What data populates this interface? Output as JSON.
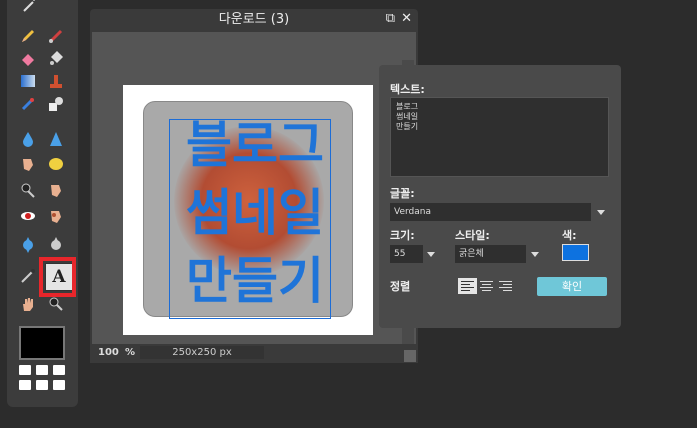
{
  "document": {
    "title": "다운로드 (3)",
    "zoom": "100",
    "zoom_unit": "%",
    "dimensions": "250x250 px"
  },
  "canvas_text": {
    "line1": "블로그",
    "line2": "썸네일",
    "line3": "만들기",
    "color": "#1f74d8"
  },
  "text_dialog": {
    "text_label": "텍스트:",
    "text_value": "블로그\n썸네일\n만들기",
    "font_label": "글꼴:",
    "font_value": "Verdana",
    "size_label": "크기:",
    "size_value": "55",
    "style_label": "스타일:",
    "style_value": "굵은체",
    "color_label": "색:",
    "color_value": "#0d72e0",
    "align_label": "정렬",
    "align_selected": "left",
    "ok_label": "확인"
  },
  "toolbar": {
    "tools": [
      "magic-wand",
      "pencil",
      "brush",
      "eraser",
      "bucket",
      "gradient",
      "stamp",
      "color-replace",
      "shape",
      "drop",
      "sharpen",
      "smudge",
      "sponge",
      "zoom",
      "dodge",
      "red-eye",
      "burn",
      "spherize",
      "pinch",
      "color-picker",
      "type",
      "hand",
      "magnifier"
    ],
    "selected_tool": "type",
    "type_tool_glyph": "A",
    "foreground_color": "#000000"
  }
}
